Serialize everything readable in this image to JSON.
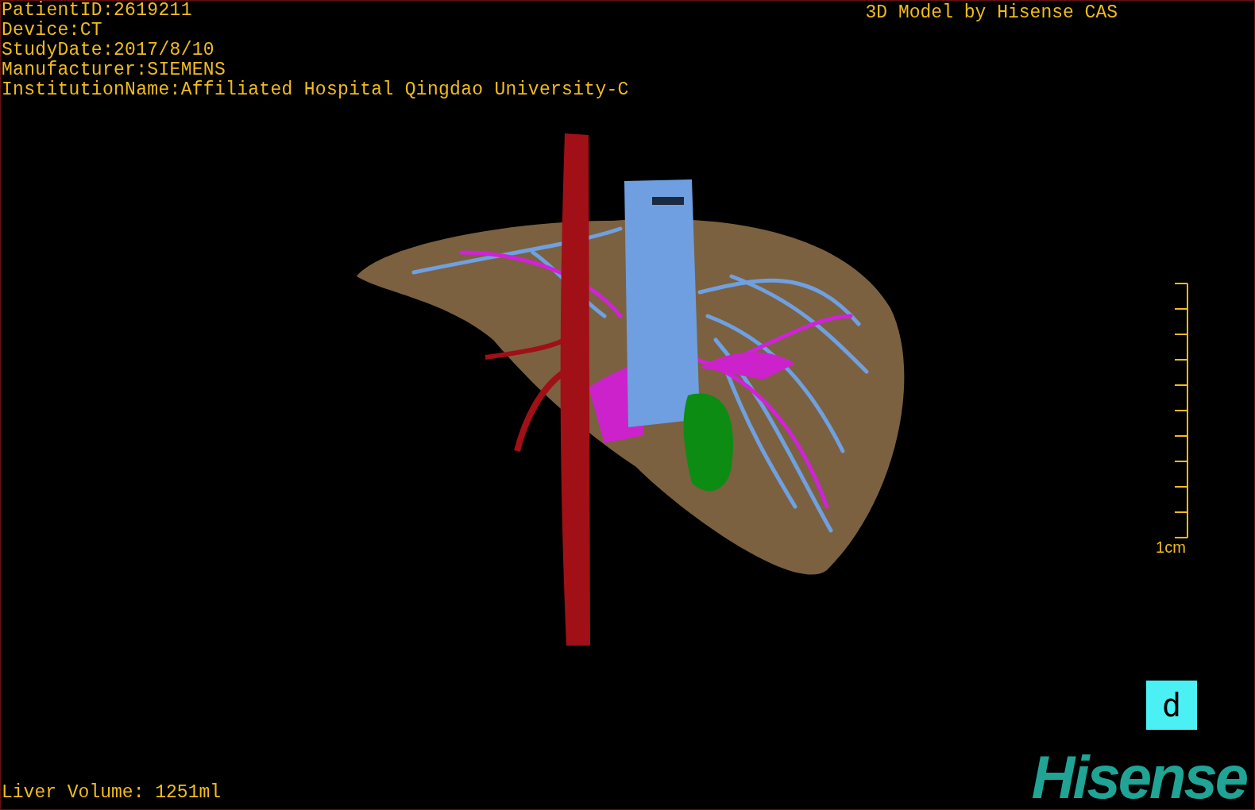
{
  "study_info": [
    "PatientID:2619211",
    "Device:CT",
    "StudyDate:2017/8/10",
    "Manufacturer:SIEMENS",
    "InstitutionName:Affiliated Hospital Qingdao University-C"
  ],
  "caption": "3D Model by Hisense CAS",
  "scale_bar": {
    "label": "1cm"
  },
  "liver_volume": "Liver Volume: 1251ml",
  "view_button": {
    "label": "d"
  },
  "logo": "Hisense"
}
